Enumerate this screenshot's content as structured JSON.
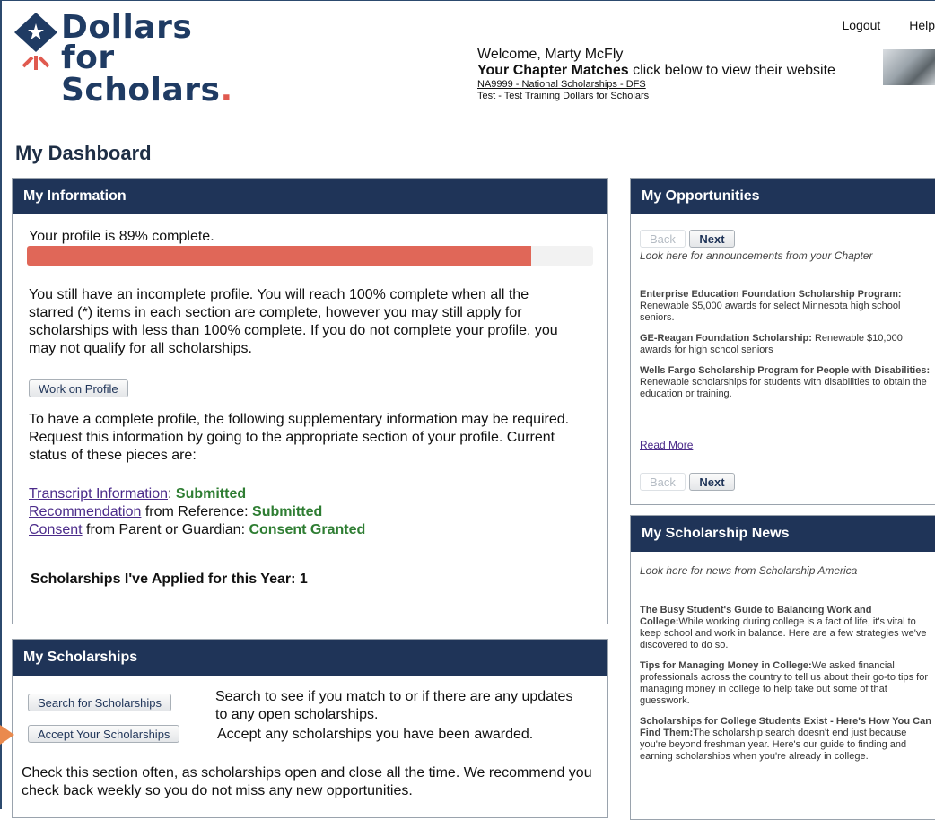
{
  "brand": {
    "line1": "Dollars for",
    "line2": "Scholars",
    "dot": "."
  },
  "top_links": {
    "logout": "Logout",
    "help": "Help"
  },
  "welcome": {
    "greeting": "Welcome, Marty McFly",
    "matches_bold": "Your Chapter Matches",
    "matches_rest": " click below to view their website",
    "chapters": [
      "NA9999 - National Scholarships - DFS",
      "Test - Test Training Dollars for Scholars"
    ]
  },
  "page_title": "My Dashboard",
  "info": {
    "heading": "My Information",
    "profile_status": "Your profile is 89% complete.",
    "progress_fraction": 0.89,
    "incomplete_text": "You still have an incomplete profile. You will reach 100% complete when all the starred (*) items in each section are complete, however you may still apply for scholarships with less than 100% complete. If you do not complete your profile, you may not qualify for all scholarships.",
    "work_button": "Work on Profile",
    "supp_text": "To have a complete profile, the following supplementary information may be required. Request this information by going to the appropriate section of your profile. Current status of these pieces are:",
    "items": [
      {
        "link": "Transcript Information",
        "rest": ": ",
        "status": "Submitted"
      },
      {
        "link": "Recommendation",
        "rest": " from Reference: ",
        "status": "Submitted"
      },
      {
        "link": "Consent",
        "rest": " from Parent or Guardian: ",
        "status": "Consent Granted"
      }
    ],
    "applied": "Scholarships I've Applied for this Year: 1"
  },
  "scholarships": {
    "heading": "My Scholarships",
    "search_button": "Search for Scholarships",
    "search_desc": "Search to see if you match to or if there are any updates to any open scholarships.",
    "accept_button": "Accept Your Scholarships",
    "accept_desc": "Accept any scholarships you have been awarded.",
    "note": "Check this section often, as scholarships open and close all the time. We recommend you check back weekly so you do not miss any new opportunities."
  },
  "opportunities": {
    "heading": "My Opportunities",
    "back": "Back",
    "next": "Next",
    "intro": "Look here for announcements from your Chapter",
    "items": [
      {
        "title": "Enterprise Education Foundation Scholarship Program:",
        "desc": " Renewable $5,000 awards for select Minnesota high school seniors."
      },
      {
        "title": "GE-Reagan Foundation Scholarship:",
        "desc": " Renewable $10,000 awards for high school seniors"
      },
      {
        "title": "Wells Fargo Scholarship Program for People with Disabilities:",
        "desc": " Renewable scholarships for students with disabilities to obtain the education or training."
      }
    ],
    "read_more": "Read More"
  },
  "news": {
    "heading": "My Scholarship News",
    "intro": "Look here for news from Scholarship America",
    "items": [
      {
        "title": "The Busy Student's Guide to Balancing Work and College:",
        "desc": "While working during college is a fact of life, it's vital to keep school and work in balance. Here are a few strategies we've discovered to do so."
      },
      {
        "title": "Tips for Managing Money in College:",
        "desc": "We asked financial professionals across the country to tell us about their go-to tips for managing money in college to help take out some of that guesswork."
      },
      {
        "title": "Scholarships for College Students Exist - Here's How You Can Find Them:",
        "desc": "The scholarship search doesn't end just because you're beyond freshman year. Here's our guide to finding and earning scholarships when you're already in college."
      }
    ]
  },
  "colors": {
    "navy": "#1f3458",
    "progress": "#e06758",
    "status_green": "#2e7d32",
    "accent_arrow": "#ea8a4e"
  }
}
